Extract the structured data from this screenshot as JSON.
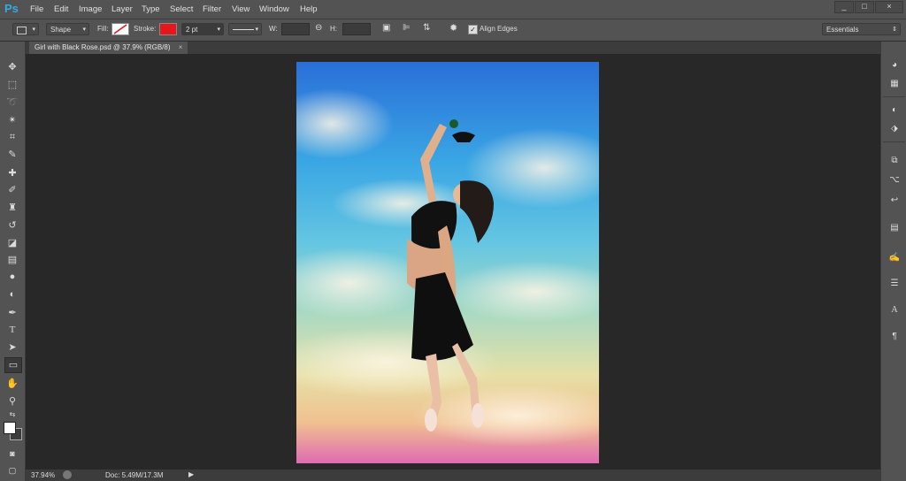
{
  "app": {
    "logo": "Ps"
  },
  "menu": [
    "File",
    "Edit",
    "Image",
    "Layer",
    "Type",
    "Select",
    "Filter",
    "View",
    "Window",
    "Help"
  ],
  "window_controls": [
    "_",
    "□",
    "×"
  ],
  "options": {
    "shape_mode": "Shape",
    "fill_label": "Fill:",
    "stroke_label": "Stroke:",
    "stroke_color": "#e8161c",
    "stroke_width": "2 pt",
    "w_label": "W:",
    "h_label": "H:",
    "align_edges_label": "Align Edges",
    "workspace": "Essentials"
  },
  "document": {
    "tab_title": "Girl with Black Rose.psd @ 37.9% (RGB/8)",
    "close": "×"
  },
  "status": {
    "zoom": "37.94%",
    "doc": "Doc: 5.49M/17.3M"
  },
  "tools": [
    "move-tool",
    "marquee-tool",
    "lasso-tool",
    "magic-wand-tool",
    "crop-tool",
    "eyedropper-tool",
    "spot-healing-tool",
    "brush-tool",
    "clone-stamp-tool",
    "history-brush-tool",
    "eraser-tool",
    "gradient-tool",
    "blur-tool",
    "dodge-tool",
    "pen-tool",
    "type-tool",
    "path-selection-tool",
    "rectangle-tool",
    "hand-tool",
    "zoom-tool"
  ],
  "colors": {
    "foreground": "#ffffff",
    "background": "#3c3c3c"
  }
}
